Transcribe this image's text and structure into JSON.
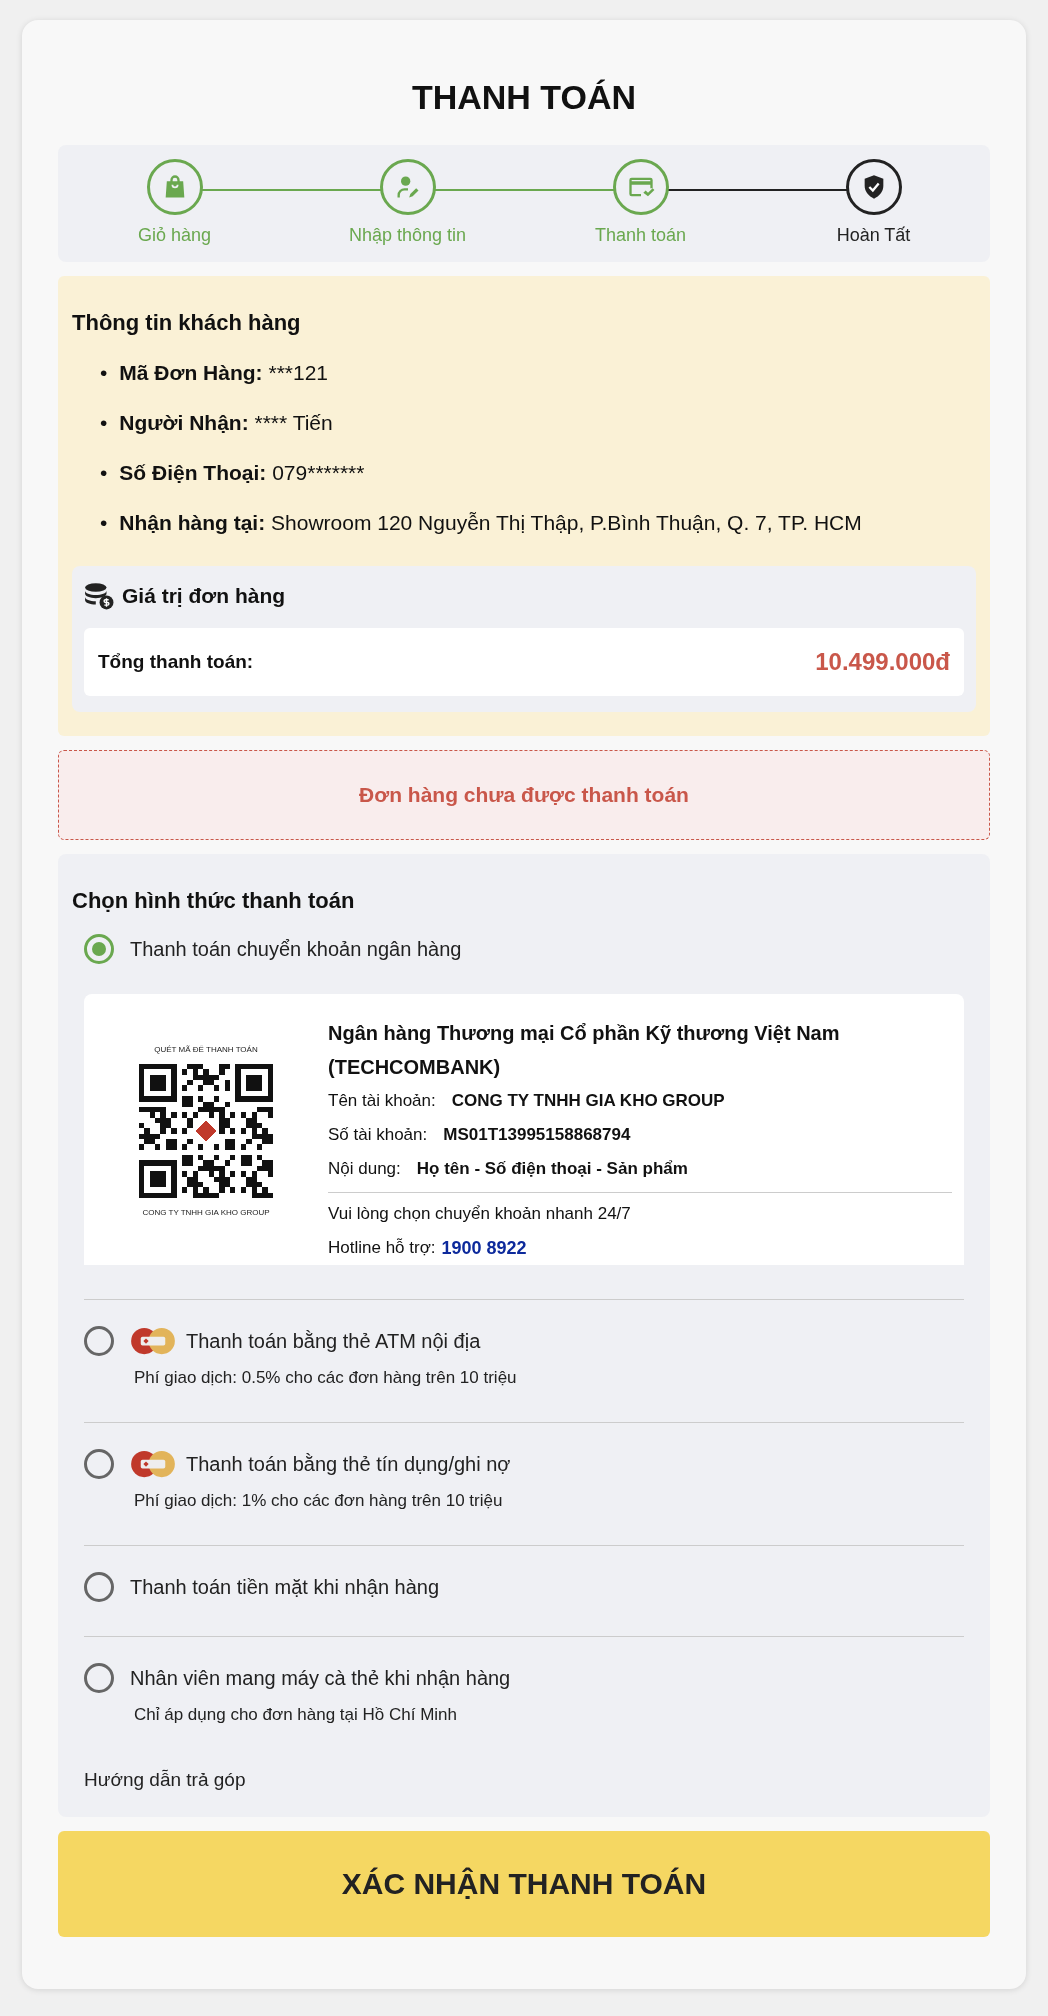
{
  "title": "THANH TOÁN",
  "steps": [
    {
      "label": "Giỏ hàng",
      "done": true
    },
    {
      "label": "Nhập thông tin",
      "done": true
    },
    {
      "label": "Thanh toán",
      "done": true
    },
    {
      "label": "Hoàn Tất",
      "done": false
    }
  ],
  "customer": {
    "heading": "Thông tin khách hàng",
    "items": [
      {
        "marker": "•",
        "label": "Mã Đơn Hàng:",
        "value": "***121"
      },
      {
        "marker": "•",
        "label": "Người Nhận:",
        "value": "**** Tiến"
      },
      {
        "marker": "•",
        "label": "Số Điện Thoại:",
        "value": "079*******"
      },
      {
        "marker": "•",
        "label": "Nhận hàng tại:",
        "value": "Showroom 120 Nguyễn Thị Thập, P.Bình Thuận, Q. 7, TP. HCM"
      }
    ],
    "order_value": {
      "heading": "Giá trị đơn hàng",
      "total_label": "Tổng thanh toán:",
      "total": "10.499.000đ"
    }
  },
  "alert": "Đơn hàng chưa được thanh toán",
  "payment": {
    "heading": "Chọn hình thức thanh toán",
    "methods": [
      {
        "label": "Thanh toán chuyển khoản ngân hàng",
        "selected": true,
        "kind": "bank",
        "bank": {
          "qr_caption_top": "QUÉT MÃ ĐỂ THANH TOÁN",
          "qr_caption_bottom": "CONG TY TNHH GIA KHO GROUP",
          "name": "Ngân hàng Thương mại Cổ phần Kỹ thương Việt Nam (TECHCOMBANK)",
          "rows": [
            {
              "label": "Tên tài khoản:",
              "value": "CONG TY TNHH GIA KHO GROUP"
            },
            {
              "label": "Số tài khoản:",
              "value": "MS01T13995158868794"
            },
            {
              "label": "Nội dung:",
              "value": "Họ tên - Số điện thoại - Sản phẩm"
            }
          ],
          "note": "Vui lòng chọn chuyển khoản nhanh 24/7",
          "hotline_label": "Hotline hỗ trợ:",
          "hotline": "1900 8922"
        }
      },
      {
        "label": "Thanh toán bằng thẻ ATM nội địa",
        "selected": false,
        "kind": "card",
        "sub": "Phí giao dịch: 0.5% cho các đơn hàng trên 10 triệu"
      },
      {
        "label": "Thanh toán bằng thẻ tín dụng/ghi nợ",
        "selected": false,
        "kind": "card",
        "sub": "Phí giao dịch: 1% cho các đơn hàng trên 10 triệu"
      },
      {
        "label": "Thanh toán tiền mặt khi nhận hàng",
        "selected": false,
        "kind": "plain"
      },
      {
        "label": "Nhân viên mang máy cà thẻ khi nhận hàng",
        "selected": false,
        "kind": "plain",
        "sub": "Chỉ áp dụng cho đơn hàng tại Hồ Chí Minh"
      }
    ],
    "installment_link": "Hướng dẫn trả góp"
  },
  "confirm_button": "XÁC NHẬN THANH TOÁN"
}
